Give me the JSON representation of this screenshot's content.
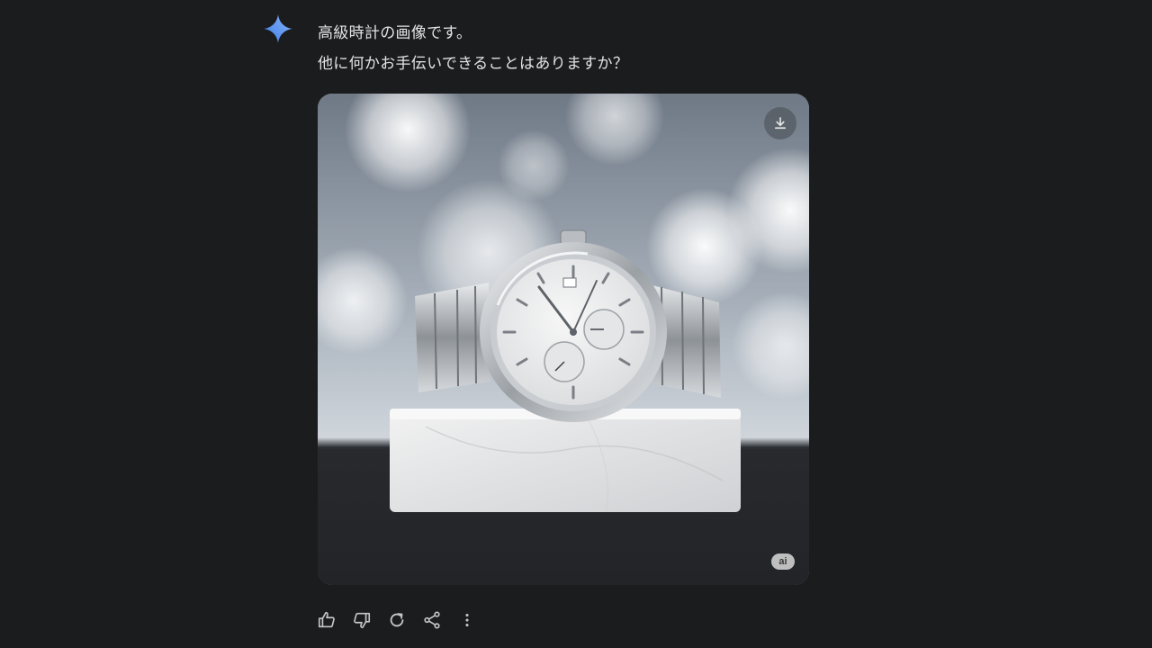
{
  "message": {
    "line1": "高級時計の画像です。",
    "line2": "他に何かお手伝いできることはありますか？"
  },
  "image": {
    "badge": "ai",
    "download_icon": "download-icon"
  },
  "actions": [
    {
      "icon": "thumbs-up-icon"
    },
    {
      "icon": "thumbs-down-icon"
    },
    {
      "icon": "regenerate-icon"
    },
    {
      "icon": "share-icon"
    },
    {
      "icon": "more-vert-icon"
    }
  ],
  "colors": {
    "background": "#1b1c1e",
    "text": "#e3e3e3",
    "icon": "#c4c7c5",
    "spark_start": "#4a90f0",
    "spark_end": "#8ab4f8"
  }
}
